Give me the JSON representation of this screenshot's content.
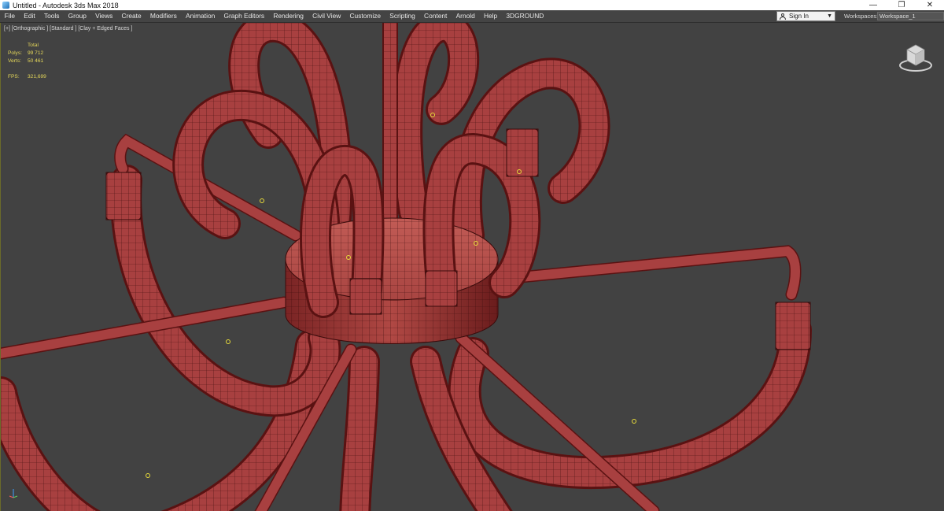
{
  "window": {
    "title": "Untitled - Autodesk 3ds Max 2018",
    "controls": {
      "minimize": "—",
      "maximize": "❐",
      "close": "✕"
    }
  },
  "menu": [
    "File",
    "Edit",
    "Tools",
    "Group",
    "Views",
    "Create",
    "Modifiers",
    "Animation",
    "Graph Editors",
    "Rendering",
    "Civil View",
    "Customize",
    "Scripting",
    "Content",
    "Arnold",
    "Help",
    "3DGROUND"
  ],
  "signin": {
    "label": "Sign In"
  },
  "workspaces": {
    "label": "Workspaces:",
    "value": "Workspace_1"
  },
  "viewport": {
    "label": "[+] [Orthographic ] [Standard ] [Clay + Edged Faces ]",
    "stats": {
      "header": "Total",
      "polys_label": "Polys:",
      "polys": "99 712",
      "verts_label": "Verts:",
      "verts": "50 461",
      "fps_label": "FPS:",
      "fps": "321,699"
    }
  },
  "colors": {
    "mesh": "#a84040",
    "mesh_dark": "#5a1212",
    "mesh_light": "#c25a55",
    "wire": "#3a0b0b",
    "viewport_bg": "#424242",
    "pivot": "#e8dc3a"
  },
  "icons": {
    "viewcube": "viewcube-icon",
    "axis": "axis-tripod-icon",
    "user": "user-icon",
    "app": "3dsmax-app-icon"
  }
}
